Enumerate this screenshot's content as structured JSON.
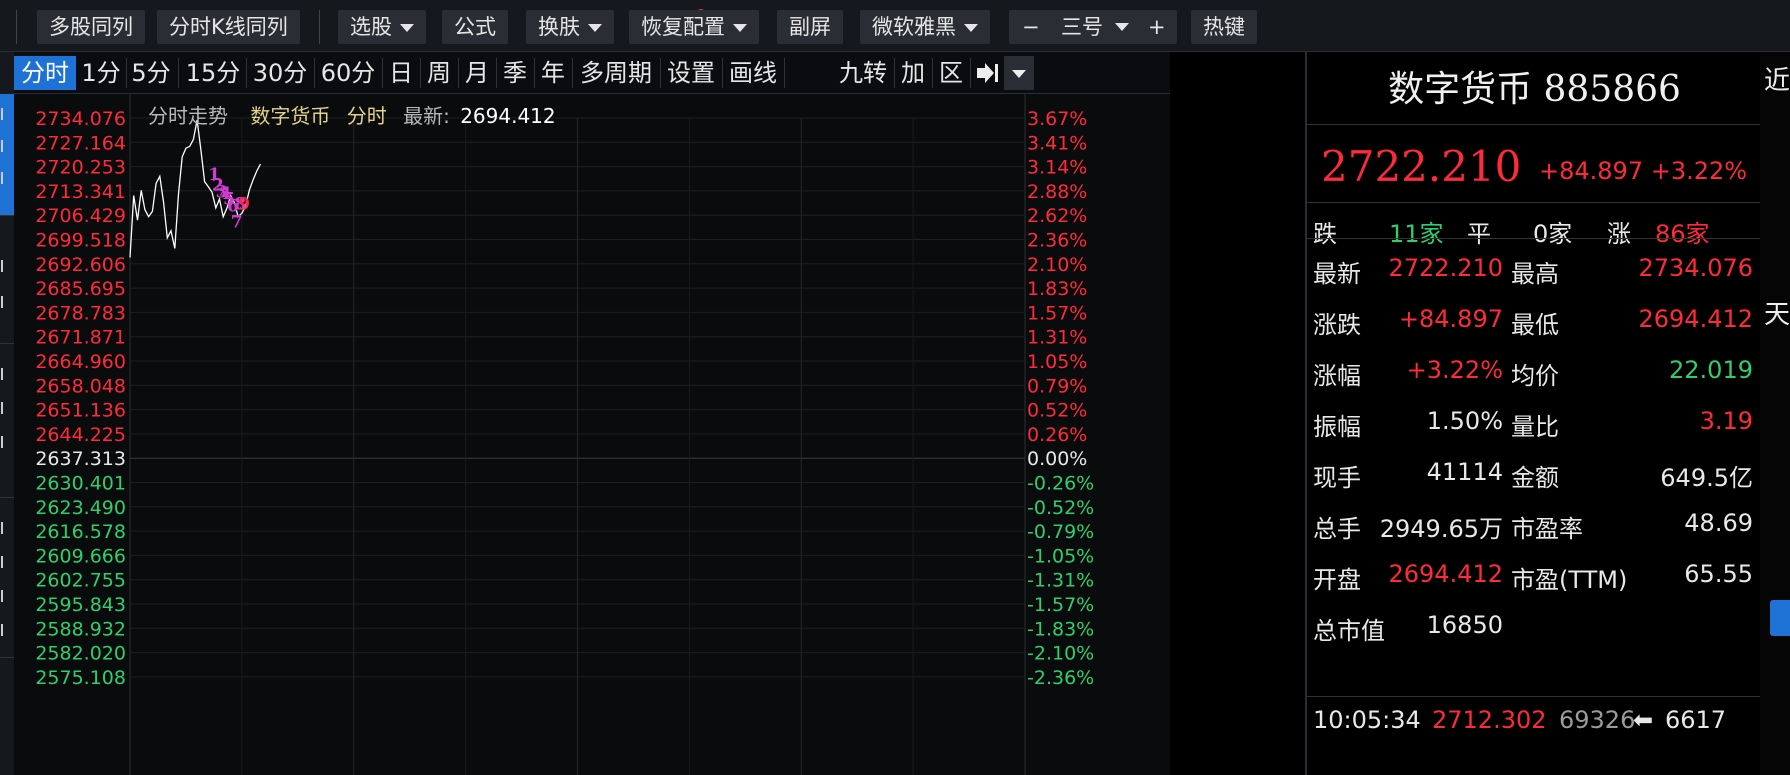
{
  "toolbar": {
    "multi_stock": "多股同列",
    "tk_same": "分时K线同列",
    "pick_stock": "选股",
    "formula": "公式",
    "skin": "换肤",
    "restore": "恢复配置",
    "sub_screen": "副屏",
    "font_name": "微软雅黑",
    "minus": "−",
    "font_size": "三号",
    "plus": "+",
    "hotkey": "热键"
  },
  "period_tabs": {
    "items": [
      "分时",
      "1分",
      "5分",
      "15分",
      "30分",
      "60分",
      "日",
      "周",
      "月",
      "季",
      "年",
      "多周期",
      "设置",
      "画线"
    ],
    "active_index": 0,
    "right_items": [
      "九转",
      "加",
      "区"
    ]
  },
  "chart_header": {
    "title": "分时走势",
    "name": "数字货币",
    "series_label": "分时",
    "latest_label": "最新:",
    "latest_value": "2694.412"
  },
  "chart_data": {
    "type": "line",
    "prev_close": 2637.313,
    "left_ticks": [
      "2734.076",
      "2727.164",
      "2720.253",
      "2713.341",
      "2706.429",
      "2699.518",
      "2692.606",
      "2685.695",
      "2678.783",
      "2671.871",
      "2664.960",
      "2658.048",
      "2651.136",
      "2644.225",
      "2637.313",
      "2630.401",
      "2623.490",
      "2616.578",
      "2609.666",
      "2602.755",
      "2595.843",
      "2588.932",
      "2582.020",
      "2575.108"
    ],
    "right_ticks": [
      "3.67%",
      "3.41%",
      "3.14%",
      "2.88%",
      "2.62%",
      "2.36%",
      "2.10%",
      "1.83%",
      "1.57%",
      "1.31%",
      "1.05%",
      "0.79%",
      "0.52%",
      "0.26%",
      "0.00%",
      "-0.26%",
      "-0.52%",
      "-0.79%",
      "-1.05%",
      "-1.31%",
      "-1.57%",
      "-1.83%",
      "-2.10%",
      "-2.36%"
    ],
    "ylim": [
      2575.108,
      2734.076
    ],
    "x_minutes": [
      0,
      1,
      2,
      3,
      4,
      5,
      6,
      7,
      8,
      9,
      10,
      11,
      12,
      13,
      14,
      15,
      16,
      17,
      18,
      19,
      20,
      21,
      22,
      23,
      24,
      25,
      26,
      27,
      28,
      29,
      30,
      31,
      32,
      33,
      34,
      35
    ],
    "values": [
      2694.4,
      2712.0,
      2705.0,
      2713.5,
      2708.0,
      2706.0,
      2707.5,
      2715.5,
      2717.5,
      2710.0,
      2700.0,
      2702.0,
      2697.0,
      2712.5,
      2723.0,
      2725.5,
      2726.0,
      2728.0,
      2733.5,
      2725.0,
      2716.0,
      2714.5,
      2713.0,
      2708.5,
      2711.0,
      2706.0,
      2708.5,
      2712.0,
      2710.0,
      2706.0,
      2707.0,
      2709.0,
      2713.5,
      2716.5,
      2719.0,
      2721.0
    ],
    "x_total_minutes": 240,
    "markers": [
      {
        "label": "1",
        "minute": 21,
        "value": 2716.5,
        "color": "#d63ad6"
      },
      {
        "label": "2",
        "minute": 22,
        "value": 2713.5,
        "color": "#d63ad6"
      },
      {
        "label": "3",
        "minute": 23,
        "value": 2711.5,
        "color": "#d63ad6"
      },
      {
        "label": "4",
        "minute": 24,
        "value": 2711.0,
        "color": "#d63ad6"
      },
      {
        "label": "5",
        "minute": 25,
        "value": 2709.5,
        "color": "#d63ad6"
      },
      {
        "label": "6",
        "minute": 26,
        "value": 2707.5,
        "color": "#d63ad6"
      },
      {
        "label": "7",
        "minute": 27,
        "value": 2703.0,
        "color": "#d63ad6"
      },
      {
        "label": "8",
        "minute": 28,
        "value": 2708.0,
        "color": "#d63ad6"
      },
      {
        "label": "9",
        "minute": 29,
        "value": 2708.0,
        "color": "#ff2a3a"
      }
    ]
  },
  "quote": {
    "title": "数字货币 885866",
    "price": "2722.210",
    "change": "+84.897",
    "change_pct": "+3.22%",
    "breadth": {
      "down_label": "跌",
      "down_value": "11家",
      "flat_label": "平",
      "flat_value": "0家",
      "up_label": "涨",
      "up_value": "86家"
    },
    "rows": [
      {
        "l1": "最新",
        "v1": "2722.210",
        "c1": "red",
        "l2": "最高",
        "v2": "2734.076",
        "c2": "red"
      },
      {
        "l1": "涨跌",
        "v1": "+84.897",
        "c1": "red",
        "l2": "最低",
        "v2": "2694.412",
        "c2": "red"
      },
      {
        "l1": "涨幅",
        "v1": "+3.22%",
        "c1": "red",
        "l2": "均价",
        "v2": "22.019",
        "c2": "green"
      },
      {
        "l1": "振幅",
        "v1": "1.50%",
        "c1": "white",
        "l2": "量比",
        "v2": "3.19",
        "c2": "red"
      },
      {
        "l1": "现手",
        "v1": "41114",
        "c1": "white",
        "l2": "金额",
        "v2": "649.5亿",
        "c2": "white"
      },
      {
        "l1": "总手",
        "v1": "2949.65万",
        "c1": "white",
        "l2": "市盈率",
        "v2": "48.69",
        "c2": "white"
      },
      {
        "l1": "开盘",
        "v1": "2694.412",
        "c1": "red",
        "l2": "市盈(TTM)",
        "v2": "65.55",
        "c2": "white"
      },
      {
        "l1": "总市值",
        "v1": "16850",
        "c1": "white",
        "l2": "",
        "v2": "",
        "c2": "white"
      }
    ],
    "tick": {
      "time": "10:05:34",
      "price": "2712.302",
      "volume": "69326",
      "arrow": "⬅",
      "count": "6617"
    }
  },
  "right_strip": {
    "top_text": "近",
    "mid_text": "天"
  },
  "colors": {
    "up": "#ff2a3a",
    "down": "#2fcf6d",
    "neutral": "#e8e8e8",
    "accent": "#1e72d6",
    "line": "#ffffff"
  }
}
